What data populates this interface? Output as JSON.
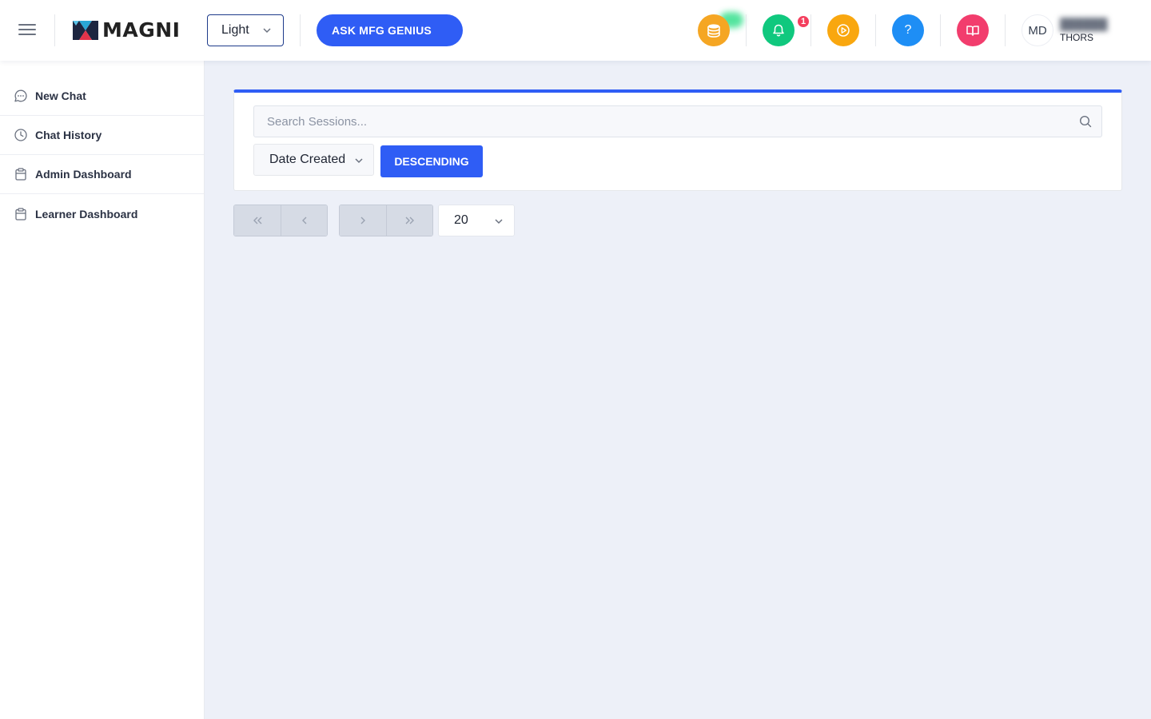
{
  "header": {
    "logo_text": "MAGNI",
    "theme": "Light",
    "ask_button": "ASK MFG GENIUS",
    "notification_count": "1",
    "help_icon": "?",
    "user_initials": "MD",
    "user_org": "THORS"
  },
  "sidebar": {
    "items": [
      {
        "label": "New Chat",
        "icon": "chat-bubble-icon"
      },
      {
        "label": "Chat History",
        "icon": "clock-icon"
      },
      {
        "label": "Admin Dashboard",
        "icon": "clipboard-icon"
      },
      {
        "label": "Learner Dashboard",
        "icon": "clipboard-icon"
      }
    ]
  },
  "main": {
    "search_placeholder": "Search Sessions...",
    "search_value": "",
    "sort_field": "Date Created",
    "sort_order": "DESCENDING",
    "page_size": "20"
  },
  "colors": {
    "primary": "#2f5df5",
    "coins": "#f5a623",
    "bell": "#10c87e",
    "play": "#f9a70f",
    "help": "#1e8ef5",
    "book": "#f23d6d"
  }
}
